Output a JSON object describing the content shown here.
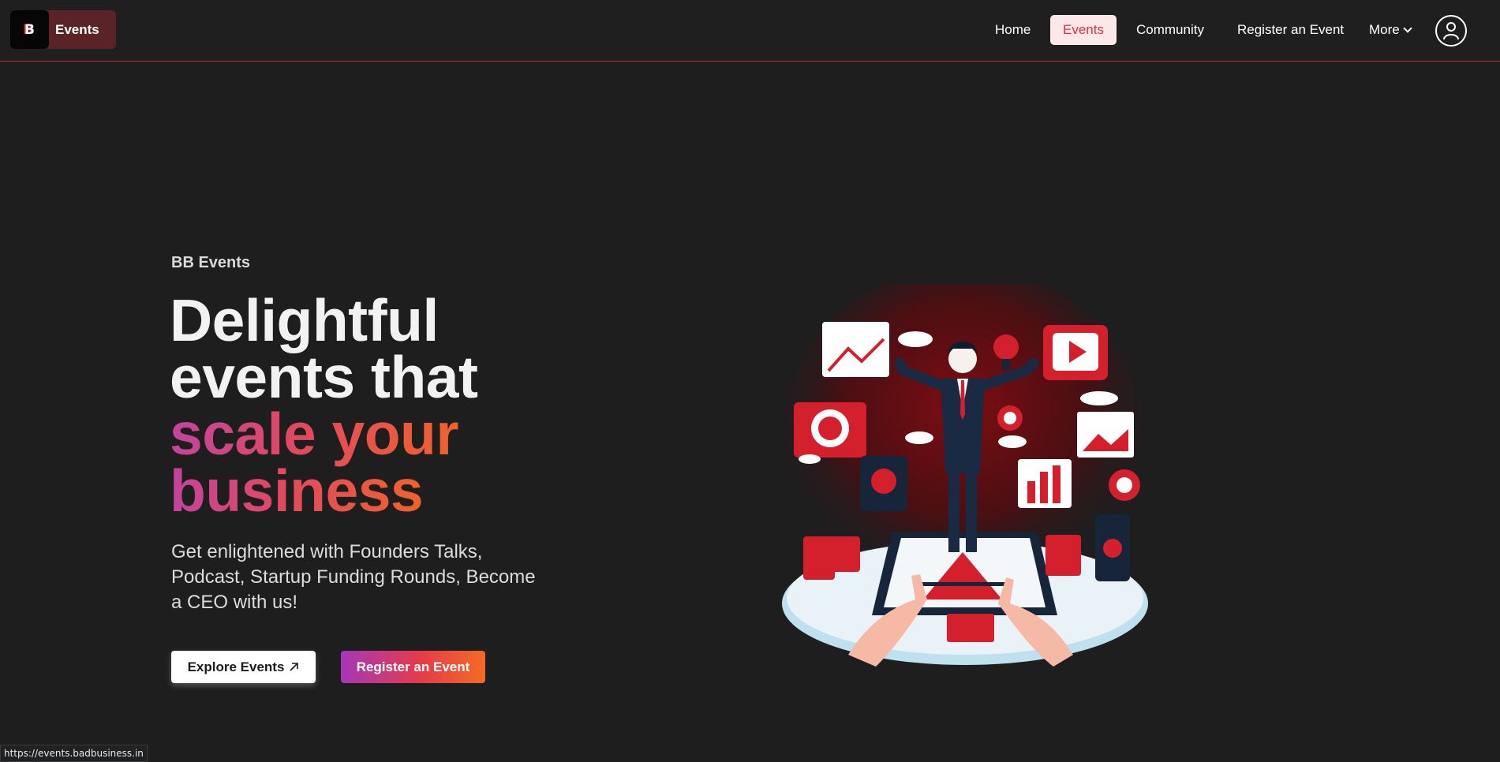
{
  "header": {
    "brand_logo": "B",
    "brand_label": "Events",
    "nav": {
      "home": "Home",
      "events": "Events",
      "community": "Community",
      "register": "Register an Event",
      "more": "More"
    },
    "active_tab": "Events",
    "accent_color": "#d8323f"
  },
  "hero": {
    "eyebrow": "BB Events",
    "headline_line1": "Delightful",
    "headline_line2": "events that",
    "headline_accent_line1": "scale your",
    "headline_accent_line2": "business",
    "subtitle": "Get enlightened with Founders Talks, Podcast, Startup Funding Rounds, Become a CEO with us!",
    "cta_primary": "Explore Events",
    "cta_secondary": "Register an Event",
    "gradient_colors": [
      "#c2449e",
      "#e1495e",
      "#f0622c"
    ]
  },
  "status_bar": {
    "url": "https://events.badbusiness.in"
  },
  "icons": [
    "user-icon",
    "chevron-down-icon",
    "arrow-up-right-icon",
    "business-illustration"
  ]
}
